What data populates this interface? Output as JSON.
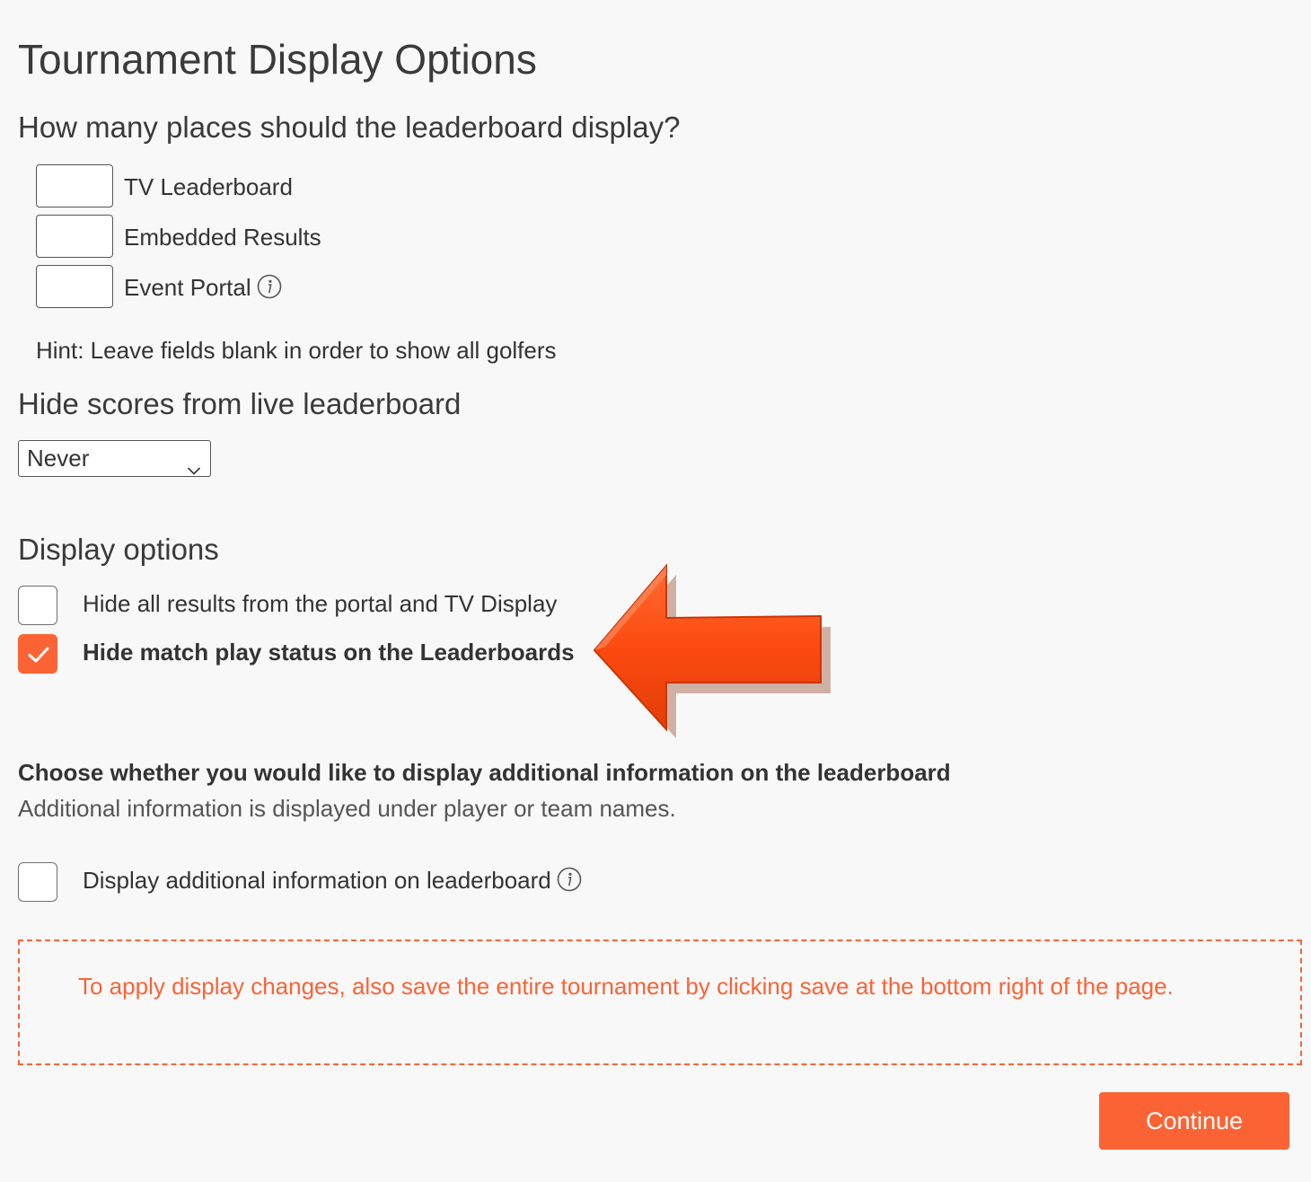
{
  "page": {
    "title": "Tournament Display Options"
  },
  "places": {
    "heading": "How many places should the leaderboard display?",
    "fields": [
      {
        "label": "TV Leaderboard",
        "value": ""
      },
      {
        "label": "Embedded Results",
        "value": ""
      },
      {
        "label": "Event Portal",
        "value": "",
        "info_icon": "info-icon"
      }
    ],
    "hint": "Hint: Leave fields blank in order to show all golfers"
  },
  "hide_scores": {
    "heading": "Hide scores from live leaderboard",
    "selected": "Never",
    "icon": "chevron-down-icon"
  },
  "display_options": {
    "heading": "Display options",
    "options": [
      {
        "label": "Hide all results from the portal and TV Display",
        "checked": false
      },
      {
        "label": "Hide match play status on the Leaderboards",
        "checked": true
      }
    ]
  },
  "additional_info": {
    "heading": "Choose whether you would like to display additional information on the leaderboard",
    "description": "Additional information is displayed under player or team names.",
    "option": {
      "label": "Display additional information on leaderboard",
      "checked": false,
      "info_icon": "info-icon"
    }
  },
  "notice": {
    "text": "To apply display changes, also save the entire tournament by clicking save at the bottom right of the page."
  },
  "footer": {
    "continue_label": "Continue"
  },
  "annotation": {
    "icon": "arrow-left-icon",
    "color": "#fc4a10"
  },
  "colors": {
    "accent": "#fb6335",
    "background": "#f8f8f8",
    "text": "#333333"
  }
}
